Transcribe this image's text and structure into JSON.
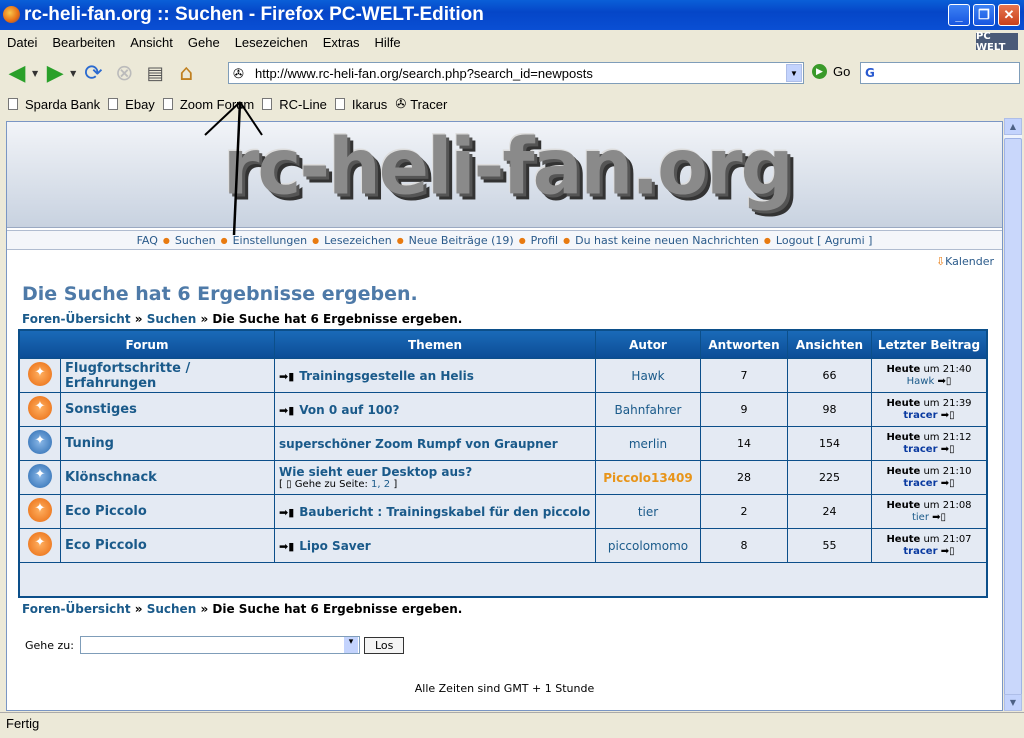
{
  "window": {
    "title": "rc-heli-fan.org :: Suchen - Firefox PC-WELT-Edition",
    "brand": "PC WELT"
  },
  "menu": [
    "Datei",
    "Bearbeiten",
    "Ansicht",
    "Gehe",
    "Lesezeichen",
    "Extras",
    "Hilfe"
  ],
  "toolbar": {
    "url": "http://www.rc-heli-fan.org/search.php?search_id=newposts",
    "go_label": "Go"
  },
  "bookmarks": [
    "Sparda Bank",
    "Ebay",
    "Zoom Forum",
    "RC-Line",
    "Ikarus",
    "Tracer"
  ],
  "site": {
    "logo": "rc-heli-fan.org",
    "nav": [
      "FAQ",
      "Suchen",
      "Einstellungen",
      "Lesezeichen",
      "Neue Beiträge (19)",
      "Profil",
      "Du hast keine neuen Nachrichten",
      "Logout [ Agrumi ]"
    ],
    "kalender": "Kalender",
    "heading": "Die Suche hat 6 Ergebnisse ergeben.",
    "crumb": {
      "home": "Foren-Übersicht",
      "search": "Suchen",
      "current": "Die Suche hat 6 Ergebnisse ergeben.",
      "sep": "»"
    },
    "columns": [
      "Forum",
      "Themen",
      "Autor",
      "Antworten",
      "Ansichten",
      "Letzter Beitrag"
    ],
    "rows": [
      {
        "forum": "Flugfortschritte / Erfahrungen",
        "topic": "Trainingsgestelle an Helis",
        "author": "Hawk",
        "replies": "7",
        "views": "66",
        "day": "Heute",
        "time": "um 21:40",
        "last": "Hawk",
        "icon": "orange"
      },
      {
        "forum": "Sonstiges",
        "topic": "Von 0 auf 100?",
        "author": "Bahnfahrer",
        "replies": "9",
        "views": "98",
        "day": "Heute",
        "time": "um 21:39",
        "last": "tracer",
        "icon": "orange"
      },
      {
        "forum": "Tuning",
        "topic": "superschöner Zoom Rumpf von Graupner",
        "author": "merlin",
        "replies": "14",
        "views": "154",
        "day": "Heute",
        "time": "um 21:12",
        "last": "tracer",
        "icon": "blue"
      },
      {
        "forum": "Klönschnack",
        "topic": "Wie sieht euer Desktop aus?",
        "pages_prefix": "[",
        "pages_text": "Gehe zu Seite:",
        "pages": "1, 2",
        "pages_suffix": "]",
        "author": "Piccolo13409",
        "replies": "28",
        "views": "225",
        "day": "Heute",
        "time": "um 21:10",
        "last": "tracer",
        "icon": "blue"
      },
      {
        "forum": "Eco Piccolo",
        "topic": "Baubericht : Trainingskabel für den piccolo",
        "author": "tier",
        "replies": "2",
        "views": "24",
        "day": "Heute",
        "time": "um 21:08",
        "last": "tier",
        "icon": "orange"
      },
      {
        "forum": "Eco Piccolo",
        "topic": "Lipo Saver",
        "author": "piccolomomo",
        "replies": "8",
        "views": "55",
        "day": "Heute",
        "time": "um 21:07",
        "last": "tracer",
        "icon": "orange"
      }
    ],
    "goto_label": "Gehe zu:",
    "goto_button": "Los",
    "timezone": "Alle Zeiten sind GMT + 1 Stunde"
  },
  "status": "Fertig"
}
